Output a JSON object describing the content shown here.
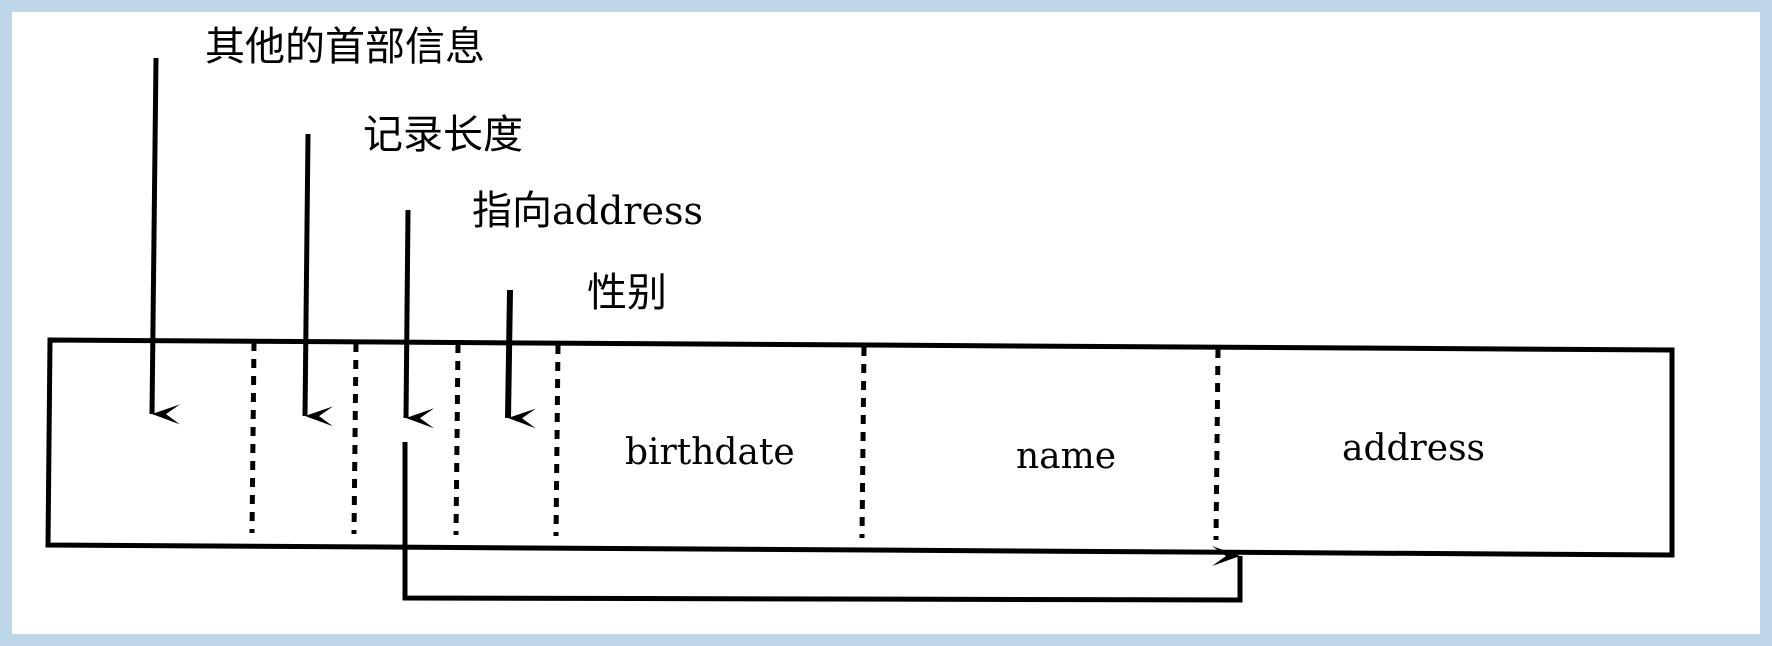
{
  "labels": {
    "other_header": "其他的首部信息",
    "record_length": "记录长度",
    "pointer_cn": "指向",
    "pointer_target": "address",
    "gender": "性别"
  },
  "fields": {
    "birthdate": "birthdate",
    "name": "name",
    "address": "address"
  }
}
